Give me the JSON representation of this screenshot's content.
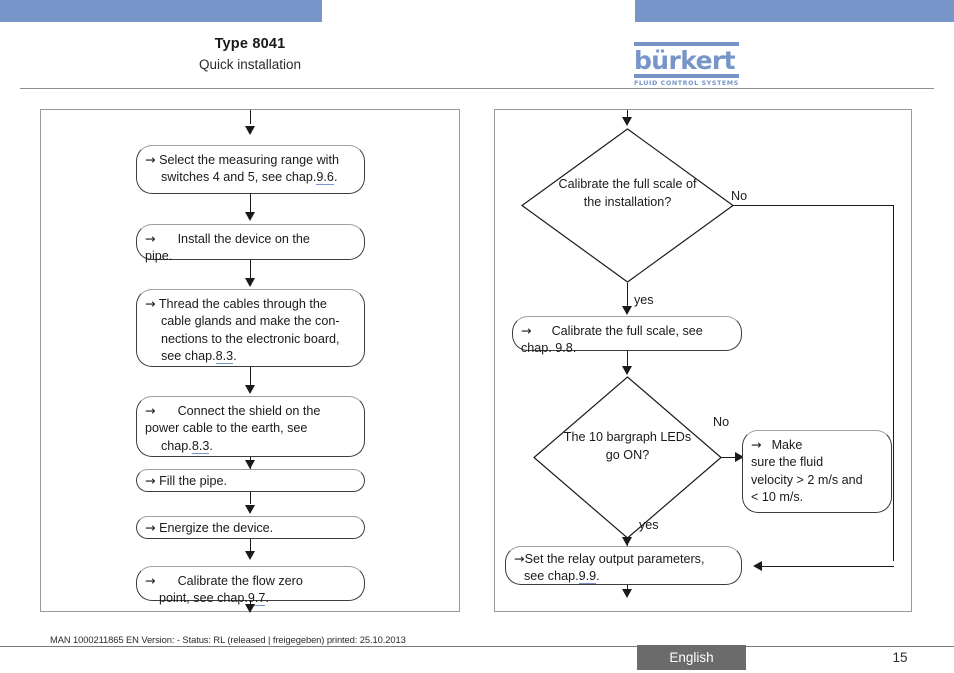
{
  "header": {
    "title": "Type 8041",
    "subtitle": "Quick installation",
    "logo_word": "bürkert",
    "logo_tagline": "FLUID CONTROL SYSTEMS"
  },
  "colors": {
    "brand_blue": "#7795c8",
    "frame_gray": "#9a9a9a",
    "badge_gray": "#6b6b6b",
    "link_underline": "#7795c8"
  },
  "left_flow": {
    "steps": [
      {
        "id": "select-measuring-range",
        "line1": "Select the measuring range with",
        "line2_pre": "switches 4 and 5, see chap. ",
        "chapter": "9.6",
        "line2_post": "."
      },
      {
        "id": "install-device",
        "line1": "Install the device on the",
        "line2_pre": "pipe.",
        "chapter": "",
        "line2_post": ""
      },
      {
        "id": "thread-cables",
        "line1": "Thread the cables through the",
        "line2": "cable glands and make the con-",
        "line3": "nections to the electronic board,",
        "line4_pre": "see chap. ",
        "chapter": "8.3",
        "line4_post": "."
      },
      {
        "id": "connect-shield",
        "line1": "Connect the shield on the",
        "line2": "power cable to the earth, see",
        "line3_pre": "chap. ",
        "chapter": "8.3",
        "line3_post": "."
      },
      {
        "id": "fill-pipe",
        "line1": "Fill the pipe."
      },
      {
        "id": "energize-device",
        "line1": "Energize the device."
      },
      {
        "id": "calibrate-flow-zero",
        "line1": "Calibrate the flow zero",
        "line2_pre": "point, see chap. ",
        "chapter": "9.7",
        "line2_post": "."
      }
    ]
  },
  "right_flow": {
    "decision1": {
      "line1": "Calibrate the full scale of",
      "line2": "the installation?",
      "yes_label": "yes",
      "no_label": "No"
    },
    "step_calibrate_full_scale": {
      "line1": "Calibrate the full scale, see",
      "line2_pre": "chap. 9.8.",
      "chapter": "",
      "line2_post": ""
    },
    "decision2": {
      "line1": "The 10 bargraph LEDs",
      "line2": "go ON?",
      "yes_label": "yes",
      "no_label": "No"
    },
    "step_make_sure": {
      "line1": "Make",
      "line2": "sure the fluid",
      "line3": "velocity > 2 m/s and",
      "line4": "< 10 m/s."
    },
    "step_set_relay": {
      "line1": "Set the relay output parameters,",
      "line2_pre": "see chap. ",
      "chapter": "9.9",
      "line2_post": "."
    }
  },
  "footer": {
    "meta": "MAN 1000211865 EN Version: - Status: RL (released | freigegeben) printed: 25.10.2013",
    "language": "English",
    "page": "15"
  },
  "glyphs": {
    "arrow_right": "→"
  }
}
